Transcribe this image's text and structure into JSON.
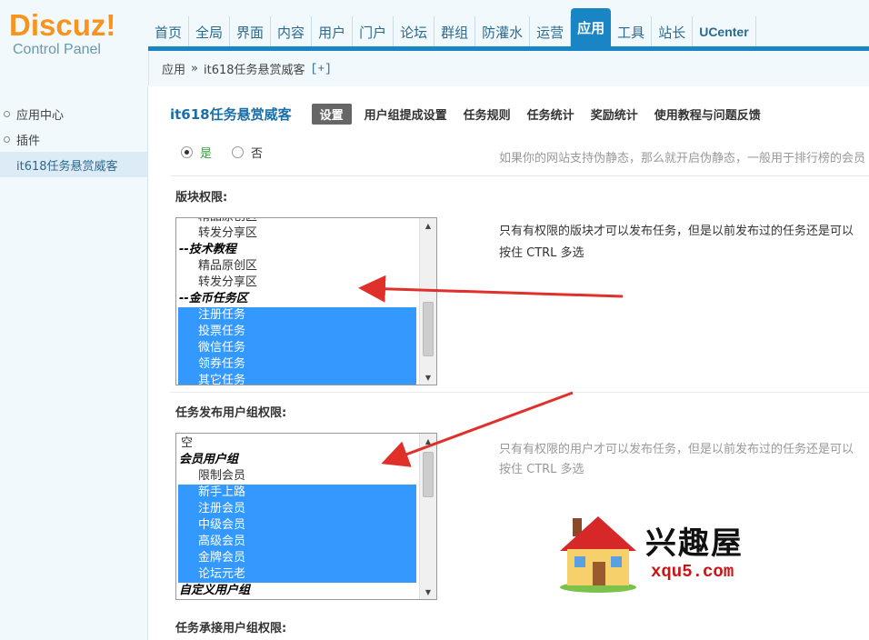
{
  "logo": {
    "main": "Discuz!",
    "sub": "Control Panel"
  },
  "nav": [
    "首页",
    "全局",
    "界面",
    "内容",
    "用户",
    "门户",
    "论坛",
    "群组",
    "防灌水",
    "运营",
    "应用",
    "工具",
    "站长",
    "UCenter"
  ],
  "nav_active": "应用",
  "breadcrumb": {
    "root": "应用",
    "sep": "»",
    "current": "it618任务悬赏威客",
    "add": "[+]"
  },
  "sidebar": {
    "items": [
      "应用中心",
      "插件",
      "it618任务悬赏威客"
    ]
  },
  "page": {
    "title": "it618任务悬赏威客",
    "tabs": [
      "设置",
      "用户组提成设置",
      "任务规则",
      "任务统计",
      "奖励统计",
      "使用教程与问题反馈"
    ]
  },
  "rewrite": {
    "yes": "是",
    "no": "否",
    "tip": "如果你的网站支持伪静态，那么就开启伪静态，一般用于排行榜的会员"
  },
  "forum_perm": {
    "label": "版块权限:",
    "tip1": "只有有权限的版块才可以发布任务，但是以前发布过的任务还是可以",
    "tip2": "按住 CTRL 多选",
    "options": [
      "精品原创区",
      "转发分享区",
      "--技术教程",
      "精品原创区",
      "转发分享区",
      "--金币任务区",
      "注册任务",
      "投票任务",
      "微信任务",
      "领券任务",
      "其它任务"
    ]
  },
  "publish_perm": {
    "label": "任务发布用户组权限:",
    "tip1": "只有有权限的用户才可以发布任务，但是以前发布过的任务还是可以",
    "tip2": "按住 CTRL 多选",
    "options": [
      "空",
      "会员用户组",
      "限制会员",
      "新手上路",
      "注册会员",
      "中级会员",
      "高级会员",
      "金牌会员",
      "论坛元老",
      "自定义用户组"
    ]
  },
  "accept_perm": {
    "label": "任务承接用户组权限:"
  },
  "watermark": {
    "text": "兴趣屋",
    "url": "xqu5.com"
  },
  "colors": {
    "accent": "#1a85c4",
    "logo": "#f7941d",
    "selection": "#3399ff",
    "arrow": "#e0302a"
  }
}
